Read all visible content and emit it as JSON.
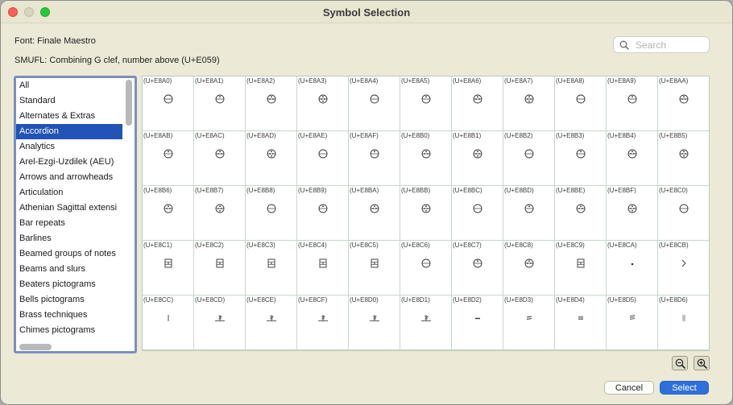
{
  "window": {
    "title": "Symbol Selection"
  },
  "font_line": "Font:  Finale Maestro",
  "smufl_line": "SMUFL: Combining G clef, number above (U+E059)",
  "search": {
    "placeholder": "Search",
    "value": ""
  },
  "categories": {
    "selected": "Accordion",
    "items": [
      "All",
      "Standard",
      "Alternates & Extras",
      "Accordion",
      "Analytics",
      "Arel-Ezgi-Uzdilek (AEU)",
      "Arrows and arrowheads",
      "Articulation",
      "Athenian Sagittal extensi",
      "Bar repeats",
      "Barlines",
      "Beamed groups of notes",
      "Beams and slurs",
      "Beaters pictograms",
      "Bells pictograms",
      "Brass techniques",
      "Chimes pictograms"
    ]
  },
  "symbols": [
    {
      "code": "(U+E8A0)",
      "icon": "accordion-register-icon"
    },
    {
      "code": "(U+E8A1)",
      "icon": "accordion-register-icon"
    },
    {
      "code": "(U+E8A2)",
      "icon": "accordion-register-icon"
    },
    {
      "code": "(U+E8A3)",
      "icon": "accordion-register-icon"
    },
    {
      "code": "(U+E8A4)",
      "icon": "accordion-register-icon"
    },
    {
      "code": "(U+E8A5)",
      "icon": "accordion-register-icon"
    },
    {
      "code": "(U+E8A6)",
      "icon": "accordion-register-icon"
    },
    {
      "code": "(U+E8A7)",
      "icon": "accordion-register-icon"
    },
    {
      "code": "(U+E8A8)",
      "icon": "accordion-register-icon"
    },
    {
      "code": "(U+E8A9)",
      "icon": "accordion-register-icon"
    },
    {
      "code": "(U+E8AA)",
      "icon": "accordion-register-icon"
    },
    {
      "code": "(U+E8AB)",
      "icon": "accordion-register-icon"
    },
    {
      "code": "(U+E8AC)",
      "icon": "accordion-register-icon"
    },
    {
      "code": "(U+E8AD)",
      "icon": "accordion-register-icon"
    },
    {
      "code": "(U+E8AE)",
      "icon": "accordion-register-icon"
    },
    {
      "code": "(U+E8AF)",
      "icon": "accordion-register-icon"
    },
    {
      "code": "(U+E8B0)",
      "icon": "accordion-register-icon"
    },
    {
      "code": "(U+E8B1)",
      "icon": "accordion-register-icon"
    },
    {
      "code": "(U+E8B2)",
      "icon": "accordion-register-icon"
    },
    {
      "code": "(U+E8B3)",
      "icon": "accordion-register-icon"
    },
    {
      "code": "(U+E8B4)",
      "icon": "accordion-register-icon"
    },
    {
      "code": "(U+E8B5)",
      "icon": "accordion-register-icon"
    },
    {
      "code": "(U+E8B6)",
      "icon": "accordion-register-icon"
    },
    {
      "code": "(U+E8B7)",
      "icon": "accordion-register-icon"
    },
    {
      "code": "(U+E8B8)",
      "icon": "accordion-register-icon"
    },
    {
      "code": "(U+E8B9)",
      "icon": "accordion-register-icon"
    },
    {
      "code": "(U+E8BA)",
      "icon": "accordion-register-icon"
    },
    {
      "code": "(U+E8BB)",
      "icon": "accordion-register-icon"
    },
    {
      "code": "(U+E8BC)",
      "icon": "accordion-register-icon"
    },
    {
      "code": "(U+E8BD)",
      "icon": "accordion-register-icon"
    },
    {
      "code": "(U+E8BE)",
      "icon": "accordion-register-icon"
    },
    {
      "code": "(U+E8BF)",
      "icon": "accordion-register-icon"
    },
    {
      "code": "(U+E8C0)",
      "icon": "accordion-register-icon"
    },
    {
      "code": "(U+E8C1)",
      "icon": "accordion-box-icon"
    },
    {
      "code": "(U+E8C2)",
      "icon": "accordion-box-icon"
    },
    {
      "code": "(U+E8C3)",
      "icon": "accordion-box-icon"
    },
    {
      "code": "(U+E8C4)",
      "icon": "accordion-box-icon"
    },
    {
      "code": "(U+E8C5)",
      "icon": "accordion-box-icon"
    },
    {
      "code": "(U+E8C6)",
      "icon": "accordion-register-icon"
    },
    {
      "code": "(U+E8C7)",
      "icon": "accordion-register-icon"
    },
    {
      "code": "(U+E8C8)",
      "icon": "accordion-register-icon"
    },
    {
      "code": "(U+E8C9)",
      "icon": "accordion-box-icon"
    },
    {
      "code": "(U+E8CA)",
      "icon": "dot-icon"
    },
    {
      "code": "(U+E8CB)",
      "icon": "chevron-right-icon"
    },
    {
      "code": "(U+E8CC)",
      "icon": "bar-icon"
    },
    {
      "code": "(U+E8CD)",
      "icon": "bellows-icon"
    },
    {
      "code": "(U+E8CE)",
      "icon": "bellows-icon"
    },
    {
      "code": "(U+E8CF)",
      "icon": "bellows-icon"
    },
    {
      "code": "(U+E8D0)",
      "icon": "bellows-icon"
    },
    {
      "code": "(U+E8D1)",
      "icon": "bellows-icon"
    },
    {
      "code": "(U+E8D2)",
      "icon": "dash-icon"
    },
    {
      "code": "(U+E8D3)",
      "icon": "double-wave-icon"
    },
    {
      "code": "(U+E8D4)",
      "icon": "triple-bar-icon"
    },
    {
      "code": "(U+E8D5)",
      "icon": "wave-stack-icon"
    },
    {
      "code": "(U+E8D6)",
      "icon": "multi-bar-icon"
    }
  ],
  "zoom": {
    "out_icon": "zoom-out-icon",
    "in_icon": "zoom-in-icon"
  },
  "buttons": {
    "cancel": "Cancel",
    "select": "Select"
  },
  "colors": {
    "selection": "#2253b8",
    "primary_button": "#2f6fdc",
    "list_focus_ring": "#7c8fc2",
    "grid_line": "#c4d8ca"
  }
}
